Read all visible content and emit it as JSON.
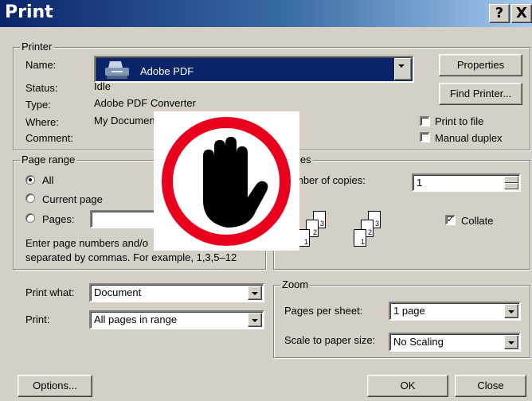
{
  "window": {
    "title": "Print",
    "help_button": "?",
    "close_button": "X"
  },
  "printer": {
    "group_label": "Printer",
    "name_label": "Name:",
    "name_value": "Adobe PDF",
    "status_label": "Status:",
    "status_value": "Idle",
    "type_label": "Type:",
    "type_value": "Adobe PDF Converter",
    "where_label": "Where:",
    "where_value": "My Documen",
    "comment_label": "Comment:",
    "properties_button": "Properties",
    "find_printer_button": "Find Printer...",
    "print_to_file_label": "Print to file",
    "manual_duplex_label": "Manual duplex",
    "print_to_file_checked": false,
    "manual_duplex_checked": false
  },
  "page_range": {
    "group_label": "Page range",
    "all_label": "All",
    "current_page_label": "Current page",
    "pages_label": "Pages:",
    "pages_value": "",
    "hint_line1": "Enter page numbers and/o",
    "hint_line2": "separated by commas.  For example, 1,3,5–12",
    "selected": "all"
  },
  "copies": {
    "group_label": "ies",
    "number_label": "mber of copies:",
    "number_value": "1",
    "collate_label": "Collate",
    "collate_checked": true,
    "pages_front": [
      "3",
      "2",
      "1"
    ],
    "pages_back": [
      "3",
      "2",
      "1"
    ]
  },
  "print_what": {
    "label": "Print what:",
    "value": "Document"
  },
  "print": {
    "label": "Print:",
    "value": "All pages in range"
  },
  "zoom": {
    "group_label": "Zoom",
    "pages_per_sheet_label": "Pages per sheet:",
    "pages_per_sheet_value": "1 page",
    "scale_label": "Scale to paper size:",
    "scale_value": "No Scaling"
  },
  "footer": {
    "options_button": "Options...",
    "ok_button": "OK",
    "close_button": "Close"
  },
  "overlay": {
    "icon": "stop-hand-icon",
    "ring_color": "#e8001c"
  },
  "colors": {
    "title_start": "#0a246a",
    "title_end": "#a6caf0",
    "selection": "#0a246a"
  }
}
